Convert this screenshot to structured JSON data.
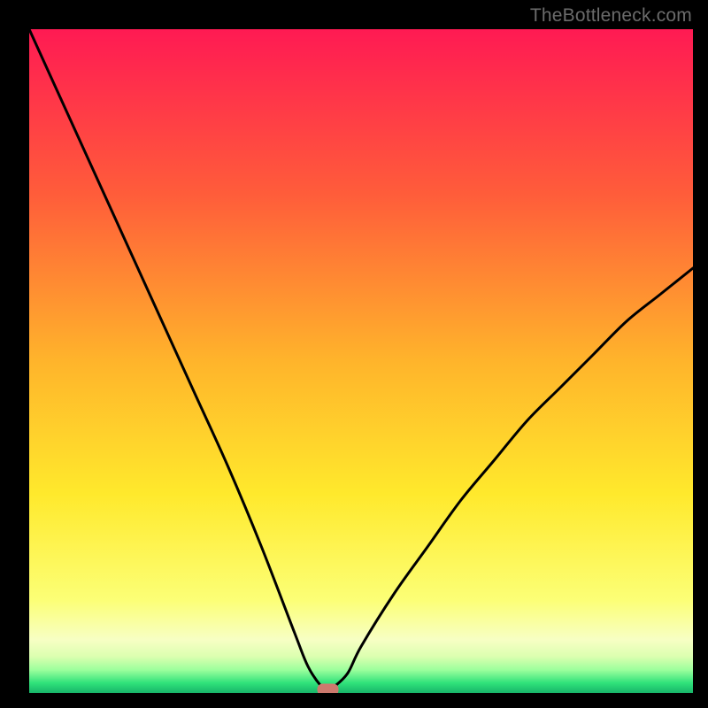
{
  "watermark": "TheBottleneck.com",
  "chart_data": {
    "type": "line",
    "title": "",
    "xlabel": "",
    "ylabel": "",
    "xlim": [
      0,
      100
    ],
    "ylim": [
      0,
      100
    ],
    "grid": false,
    "legend": false,
    "background_gradient": {
      "stops": [
        {
          "pos": 0.0,
          "color": "#ff1a53"
        },
        {
          "pos": 0.25,
          "color": "#ff5d3a"
        },
        {
          "pos": 0.5,
          "color": "#ffb42b"
        },
        {
          "pos": 0.7,
          "color": "#ffe92c"
        },
        {
          "pos": 0.86,
          "color": "#fcff76"
        },
        {
          "pos": 0.92,
          "color": "#f7ffc4"
        },
        {
          "pos": 0.945,
          "color": "#dcffb0"
        },
        {
          "pos": 0.965,
          "color": "#9dff9d"
        },
        {
          "pos": 0.985,
          "color": "#2fe27a"
        },
        {
          "pos": 1.0,
          "color": "#18b56a"
        }
      ]
    },
    "series": [
      {
        "name": "bottleneck-curve",
        "color": "#000000",
        "x": [
          0,
          5,
          10,
          15,
          20,
          25,
          30,
          35,
          40,
          42,
          44,
          45,
          46,
          48,
          50,
          55,
          60,
          65,
          70,
          75,
          80,
          85,
          90,
          95,
          100
        ],
        "values": [
          100,
          89,
          78,
          67,
          56,
          45,
          34,
          22,
          9,
          4,
          1,
          0.5,
          1,
          3,
          7,
          15,
          22,
          29,
          35,
          41,
          46,
          51,
          56,
          60,
          64
        ]
      }
    ],
    "marker": {
      "name": "optimal-point",
      "shape": "rounded-rect",
      "x": 45,
      "y": 0.5,
      "color": "#cd7a6e",
      "width_pct": 3.2,
      "height_pct": 1.8
    }
  }
}
